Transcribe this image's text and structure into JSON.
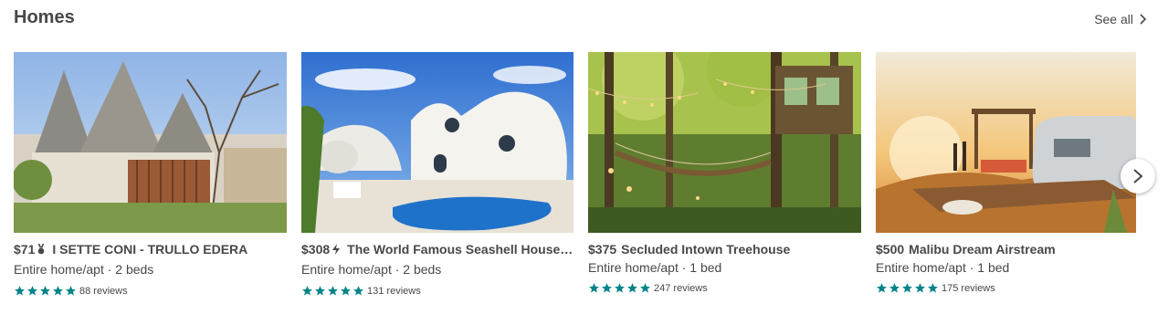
{
  "section": {
    "title": "Homes",
    "see_all": "See all"
  },
  "colors": {
    "star": "#008489",
    "text": "#484848"
  },
  "cards": [
    {
      "price": "$71",
      "badge": "superhost-medal-icon",
      "name": "I SETTE CONI - TRULLO EDERA",
      "type": "Entire home/apt · 2 beds",
      "stars": 5,
      "reviews": "88 reviews"
    },
    {
      "price": "$308",
      "badge": "instant-book-bolt-icon",
      "name": "The World Famous Seashell House ~ Casa Caracol",
      "type": "Entire home/apt · 2 beds",
      "stars": 5,
      "reviews": "131 reviews"
    },
    {
      "price": "$375",
      "badge": "",
      "name": "Secluded Intown Treehouse",
      "type": "Entire home/apt · 1 bed",
      "stars": 5,
      "reviews": "247 reviews"
    },
    {
      "price": "$500",
      "badge": "",
      "name": "Malibu Dream Airstream",
      "type": "Entire home/apt · 1 bed",
      "stars": 5,
      "reviews": "175 reviews"
    }
  ]
}
